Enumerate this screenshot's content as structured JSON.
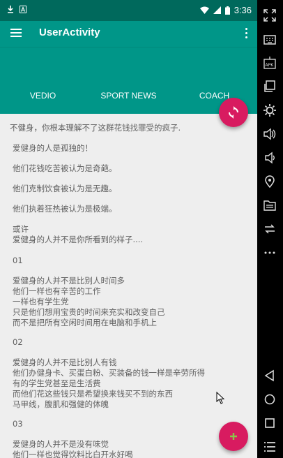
{
  "statusbar": {
    "time": "3:36"
  },
  "appbar": {
    "title": "UserActivity"
  },
  "tabs": [
    {
      "label": "VEDIO"
    },
    {
      "label": "SPORT NEWS"
    },
    {
      "label": "COACH"
    }
  ],
  "content": {
    "paragraphs": [
      "不健身，你根本理解不了这群花钱找罪受的疯子.",
      "爱健身的人是孤独的！",
      "他们花钱吃苦被认为是奇葩。",
      "他们克制饮食被认为是无趣。",
      "他们执着狂热被认为是极端。",
      "或许\n爱健身的人并不是你所看到的样子....",
      "01",
      "爱健身的人并不是比别人时间多\n他们一样也有辛苦的工作\n一样也有学生党\n只是他们想用宝贵的时间来充实和改变自己\n而不是把所有空闲时间用在电脑和手机上",
      "02",
      "爱健身的人并不是比别人有钱\n他们办健身卡、买蛋白粉、买装备的钱一样是辛劳所得\n有的学生党甚至是生活费\n而他们花这些钱只是希望换来钱买不到的东西\n马甲线，腹肌和强健的体魄",
      "03",
      "爱健身的人并不是没有味觉\n他们一样也觉得饮料比白开水好喝"
    ]
  },
  "colors": {
    "primary": "#009688",
    "primary_dark": "#00695c",
    "accent": "#d81b60",
    "fab_icon_add": "#8bc34a",
    "content_bg": "#eeeeee",
    "text": "#616161"
  },
  "icons": {
    "fab_top": "refresh-icon",
    "fab_bottom": "add-icon",
    "nav_panel": [
      "fullscreen-icon",
      "keyboard-icon",
      "apk-icon",
      "copy-icon",
      "settings-icon",
      "volume-up-icon",
      "volume-down-icon",
      "location-icon",
      "folder-icon",
      "rotate-icon",
      "more-icon",
      "back-icon",
      "home-icon",
      "recents-icon",
      "list-icon"
    ]
  }
}
